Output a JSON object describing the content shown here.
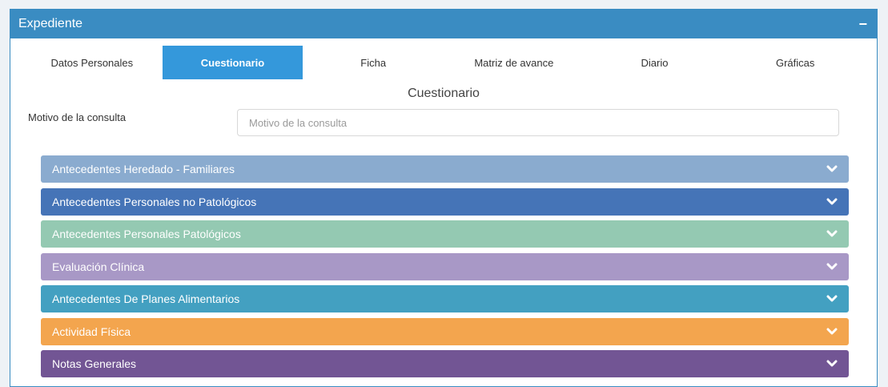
{
  "panel": {
    "title": "Expediente",
    "collapse_label": "−"
  },
  "tabs": [
    {
      "label": "Datos Personales"
    },
    {
      "label": "Cuestionario",
      "active": true
    },
    {
      "label": "Ficha"
    },
    {
      "label": "Matriz de avance"
    },
    {
      "label": "Diario"
    },
    {
      "label": "Gráficas"
    }
  ],
  "section_title": "Cuestionario",
  "motivo": {
    "label": "Motivo de la consulta",
    "placeholder": "Motivo de la consulta",
    "value": ""
  },
  "accordion": [
    {
      "label": "Antecedentes Heredado - Familiares",
      "color": "#8aabcf"
    },
    {
      "label": "Antecedentes Personales no Patológicos",
      "color": "#4574b7"
    },
    {
      "label": "Antecedentes Personales Patológicos",
      "color": "#94c9b2"
    },
    {
      "label": "Evaluación Clínica",
      "color": "#a898c6"
    },
    {
      "label": "Antecedentes De Planes Alimentarios",
      "color": "#43a0c1"
    },
    {
      "label": "Actividad Física",
      "color": "#f3a54e"
    },
    {
      "label": "Notas Generales",
      "color": "#725594"
    }
  ],
  "icons": {
    "collapse": "minus-icon",
    "expand": "chevron-down-icon"
  }
}
